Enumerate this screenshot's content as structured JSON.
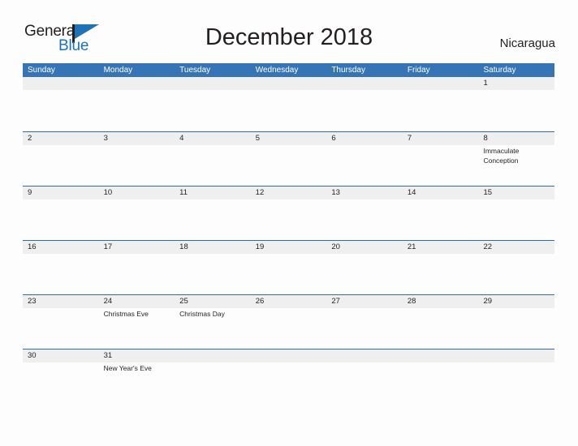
{
  "brand": {
    "name_part1": "General",
    "name_part2": "Blue",
    "flag_icon": "flag-icon",
    "accent_color": "#1e72b8"
  },
  "header": {
    "title": "December 2018",
    "country": "Nicaragua"
  },
  "calendar": {
    "header_bg": "#3575b5",
    "row_divider": "#2e6da4",
    "daynum_bg": "#efefef",
    "weekdays": [
      "Sunday",
      "Monday",
      "Tuesday",
      "Wednesday",
      "Thursday",
      "Friday",
      "Saturday"
    ],
    "weeks": [
      [
        {
          "num": "",
          "events": []
        },
        {
          "num": "",
          "events": []
        },
        {
          "num": "",
          "events": []
        },
        {
          "num": "",
          "events": []
        },
        {
          "num": "",
          "events": []
        },
        {
          "num": "",
          "events": []
        },
        {
          "num": "1",
          "events": []
        }
      ],
      [
        {
          "num": "2",
          "events": []
        },
        {
          "num": "3",
          "events": []
        },
        {
          "num": "4",
          "events": []
        },
        {
          "num": "5",
          "events": []
        },
        {
          "num": "6",
          "events": []
        },
        {
          "num": "7",
          "events": []
        },
        {
          "num": "8",
          "events": [
            "Immaculate Conception"
          ]
        }
      ],
      [
        {
          "num": "9",
          "events": []
        },
        {
          "num": "10",
          "events": []
        },
        {
          "num": "11",
          "events": []
        },
        {
          "num": "12",
          "events": []
        },
        {
          "num": "13",
          "events": []
        },
        {
          "num": "14",
          "events": []
        },
        {
          "num": "15",
          "events": []
        }
      ],
      [
        {
          "num": "16",
          "events": []
        },
        {
          "num": "17",
          "events": []
        },
        {
          "num": "18",
          "events": []
        },
        {
          "num": "19",
          "events": []
        },
        {
          "num": "20",
          "events": []
        },
        {
          "num": "21",
          "events": []
        },
        {
          "num": "22",
          "events": []
        }
      ],
      [
        {
          "num": "23",
          "events": []
        },
        {
          "num": "24",
          "events": [
            "Christmas Eve"
          ]
        },
        {
          "num": "25",
          "events": [
            "Christmas Day"
          ]
        },
        {
          "num": "26",
          "events": []
        },
        {
          "num": "27",
          "events": []
        },
        {
          "num": "28",
          "events": []
        },
        {
          "num": "29",
          "events": []
        }
      ],
      [
        {
          "num": "30",
          "events": []
        },
        {
          "num": "31",
          "events": [
            "New Year's Eve"
          ]
        },
        {
          "num": "",
          "events": []
        },
        {
          "num": "",
          "events": []
        },
        {
          "num": "",
          "events": []
        },
        {
          "num": "",
          "events": []
        },
        {
          "num": "",
          "events": []
        }
      ]
    ]
  }
}
